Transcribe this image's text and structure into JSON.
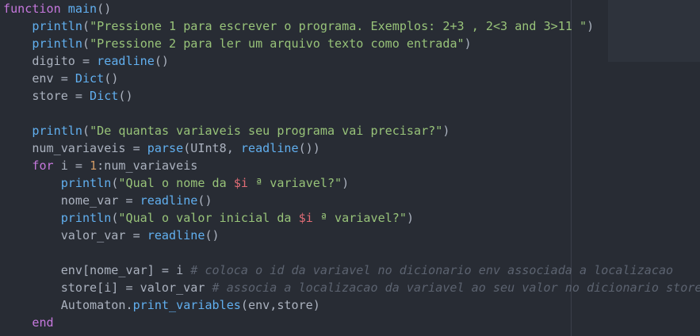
{
  "colors": {
    "background": "#282c34",
    "keyword": "#c678dd",
    "function": "#61afef",
    "string": "#98c379",
    "number": "#d19a66",
    "interpolation": "#e06c75",
    "comment": "#5c6370",
    "plain": "#abb2bf"
  },
  "code": {
    "lines": [
      [
        [
          "kw",
          "function"
        ],
        [
          "pl",
          " "
        ],
        [
          "fn",
          "main"
        ],
        [
          "pl",
          "()"
        ]
      ],
      [
        [
          "pl",
          "    "
        ],
        [
          "fn",
          "println"
        ],
        [
          "pl",
          "("
        ],
        [
          "str",
          "\"Pressione 1 para escrever o programa. Exemplos: 2+3 , 2<3 and 3>11 \""
        ],
        [
          "pl",
          ")"
        ]
      ],
      [
        [
          "pl",
          "    "
        ],
        [
          "fn",
          "println"
        ],
        [
          "pl",
          "("
        ],
        [
          "str",
          "\"Pressione 2 para ler um arquivo texto como entrada\""
        ],
        [
          "pl",
          ")"
        ]
      ],
      [
        [
          "pl",
          "    digito = "
        ],
        [
          "fn",
          "readline"
        ],
        [
          "pl",
          "()"
        ]
      ],
      [
        [
          "pl",
          "    env = "
        ],
        [
          "fn",
          "Dict"
        ],
        [
          "pl",
          "()"
        ]
      ],
      [
        [
          "pl",
          "    store = "
        ],
        [
          "fn",
          "Dict"
        ],
        [
          "pl",
          "()"
        ]
      ],
      [],
      [
        [
          "pl",
          "    "
        ],
        [
          "fn",
          "println"
        ],
        [
          "pl",
          "("
        ],
        [
          "str",
          "\"De quantas variaveis seu programa vai precisar?\""
        ],
        [
          "pl",
          ")"
        ]
      ],
      [
        [
          "pl",
          "    num_variaveis = "
        ],
        [
          "fn",
          "parse"
        ],
        [
          "pl",
          "(UInt8, "
        ],
        [
          "fn",
          "readline"
        ],
        [
          "pl",
          "())"
        ]
      ],
      [
        [
          "pl",
          "    "
        ],
        [
          "kw",
          "for"
        ],
        [
          "pl",
          " i = "
        ],
        [
          "num",
          "1"
        ],
        [
          "pl",
          ":num_variaveis"
        ]
      ],
      [
        [
          "pl",
          "        "
        ],
        [
          "fn",
          "println"
        ],
        [
          "pl",
          "("
        ],
        [
          "str",
          "\"Qual o nome da "
        ],
        [
          "ip",
          "$i"
        ],
        [
          "str",
          " ª variavel?\""
        ],
        [
          "pl",
          ")"
        ]
      ],
      [
        [
          "pl",
          "        nome_var = "
        ],
        [
          "fn",
          "readline"
        ],
        [
          "pl",
          "()"
        ]
      ],
      [
        [
          "pl",
          "        "
        ],
        [
          "fn",
          "println"
        ],
        [
          "pl",
          "("
        ],
        [
          "str",
          "\"Qual o valor inicial da "
        ],
        [
          "ip",
          "$i"
        ],
        [
          "str",
          " ª variavel?\""
        ],
        [
          "pl",
          ")"
        ]
      ],
      [
        [
          "pl",
          "        valor_var = "
        ],
        [
          "fn",
          "readline"
        ],
        [
          "pl",
          "()"
        ]
      ],
      [],
      [
        [
          "pl",
          "        env[nome_var] = i "
        ],
        [
          "cm",
          "# coloca o id da variavel no dicionario env associada a localizacao"
        ]
      ],
      [
        [
          "pl",
          "        store[i] = valor_var "
        ],
        [
          "cm",
          "# associa a localizacao da variavel ao seu valor no dicionario store"
        ]
      ],
      [
        [
          "pl",
          "        Automaton."
        ],
        [
          "fn",
          "print_variables"
        ],
        [
          "pl",
          "(env,store)"
        ]
      ],
      [
        [
          "pl",
          "    "
        ],
        [
          "kw",
          "end"
        ]
      ]
    ]
  }
}
